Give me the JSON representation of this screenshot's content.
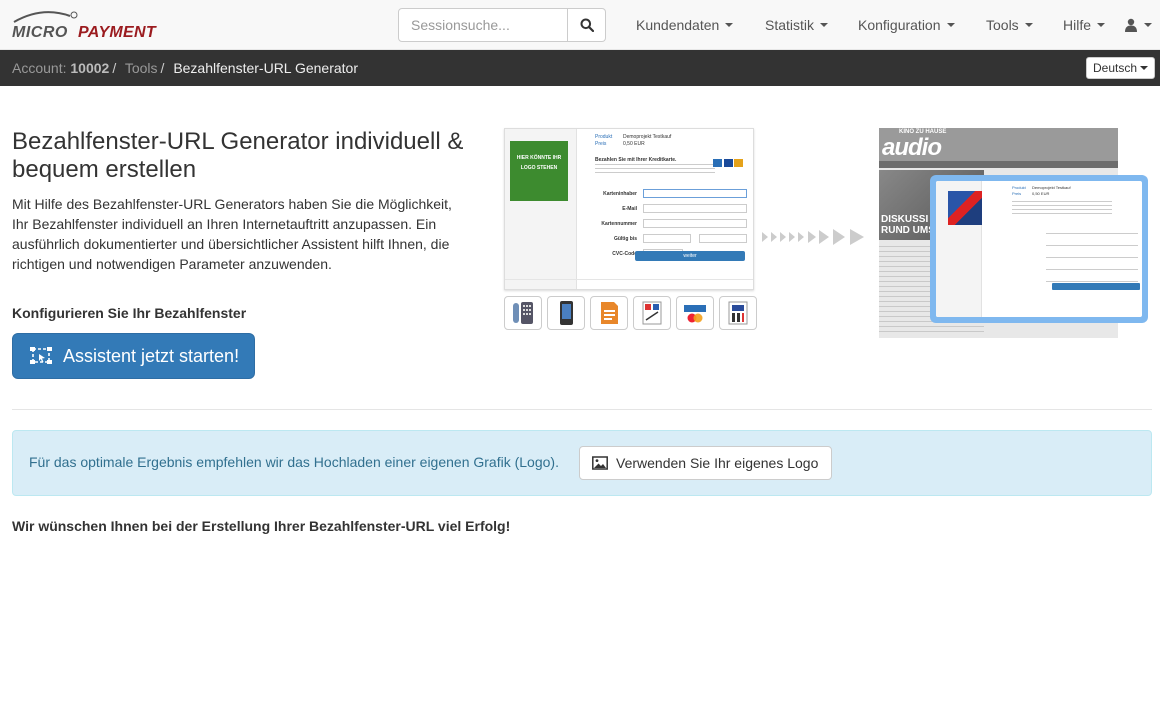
{
  "brand": {
    "logo_part1": "MICRO",
    "logo_part2": "PAYMENT",
    "accent": "#9b1b1f"
  },
  "search": {
    "placeholder": "Sessionsuche...",
    "button_icon": "search-icon"
  },
  "nav": {
    "items": [
      {
        "label": "Kundendaten"
      },
      {
        "label": "Statistik"
      },
      {
        "label": "Konfiguration"
      },
      {
        "label": "Tools"
      },
      {
        "label": "Hilfe"
      }
    ],
    "user_icon": "user-icon"
  },
  "breadcrumb": {
    "account_label": "Account:",
    "account_number": "10002",
    "tools": "Tools",
    "current": "Bezahlfenster-URL Generator"
  },
  "language": {
    "selected": "Deutsch"
  },
  "main": {
    "title": "Bezahlfenster-URL Generator individuell & bequem erstellen",
    "intro": "Mit Hilfe des Bezahlfenster-URL Generators haben Sie die Möglichkeit, Ihr Bezahlfenster individuell an Ihren Internetauftritt anzupassen. Ein ausführlich dokumentierter und übersichtlicher Assistent hilft Ihnen, die richtigen und notwendigen Parameter anzuwenden.",
    "config_label": "Konfigurieren Sie Ihr Bezahlfenster",
    "start_button": "Assistent jetzt starten!",
    "start_button_color": "#337ab7"
  },
  "info": {
    "text": "Für das optimale Ergebnis empfehlen wir das Hochladen einer eigenen Grafik (Logo).",
    "button": "Verwenden Sie Ihr eigenes Logo",
    "bg_color": "#d9edf7"
  },
  "closing": "Wir wünschen Ihnen bei der Erstellung Ihrer Bezahlfenster-URL viel Erfolg!",
  "preview": {
    "logo_text": "HIER KÖNNTE IHR LOGO STEHEN",
    "product_label": "Produkt",
    "product_value": "Demoprojekt Testkauf",
    "price_label": "Preis",
    "price_value": "0,50 EUR",
    "heading": "Bezahlen Sie mit Ihrer Kreditkarte.",
    "fields": [
      "Karteninhaber",
      "E-Mail",
      "Kartennummer",
      "Gültig bis",
      "CVC-Code"
    ],
    "submit": "weiter",
    "site_banner": "KINO ZU HAUSE",
    "site_brand": "audio",
    "site_headline": "DISKUSSI RUND UMS",
    "payment_icons": [
      "phone-payment-icon",
      "mobile-payment-icon",
      "invoice-icon",
      "direct-debit-icon",
      "credit-card-icon",
      "sofort-transfer-icon"
    ]
  }
}
